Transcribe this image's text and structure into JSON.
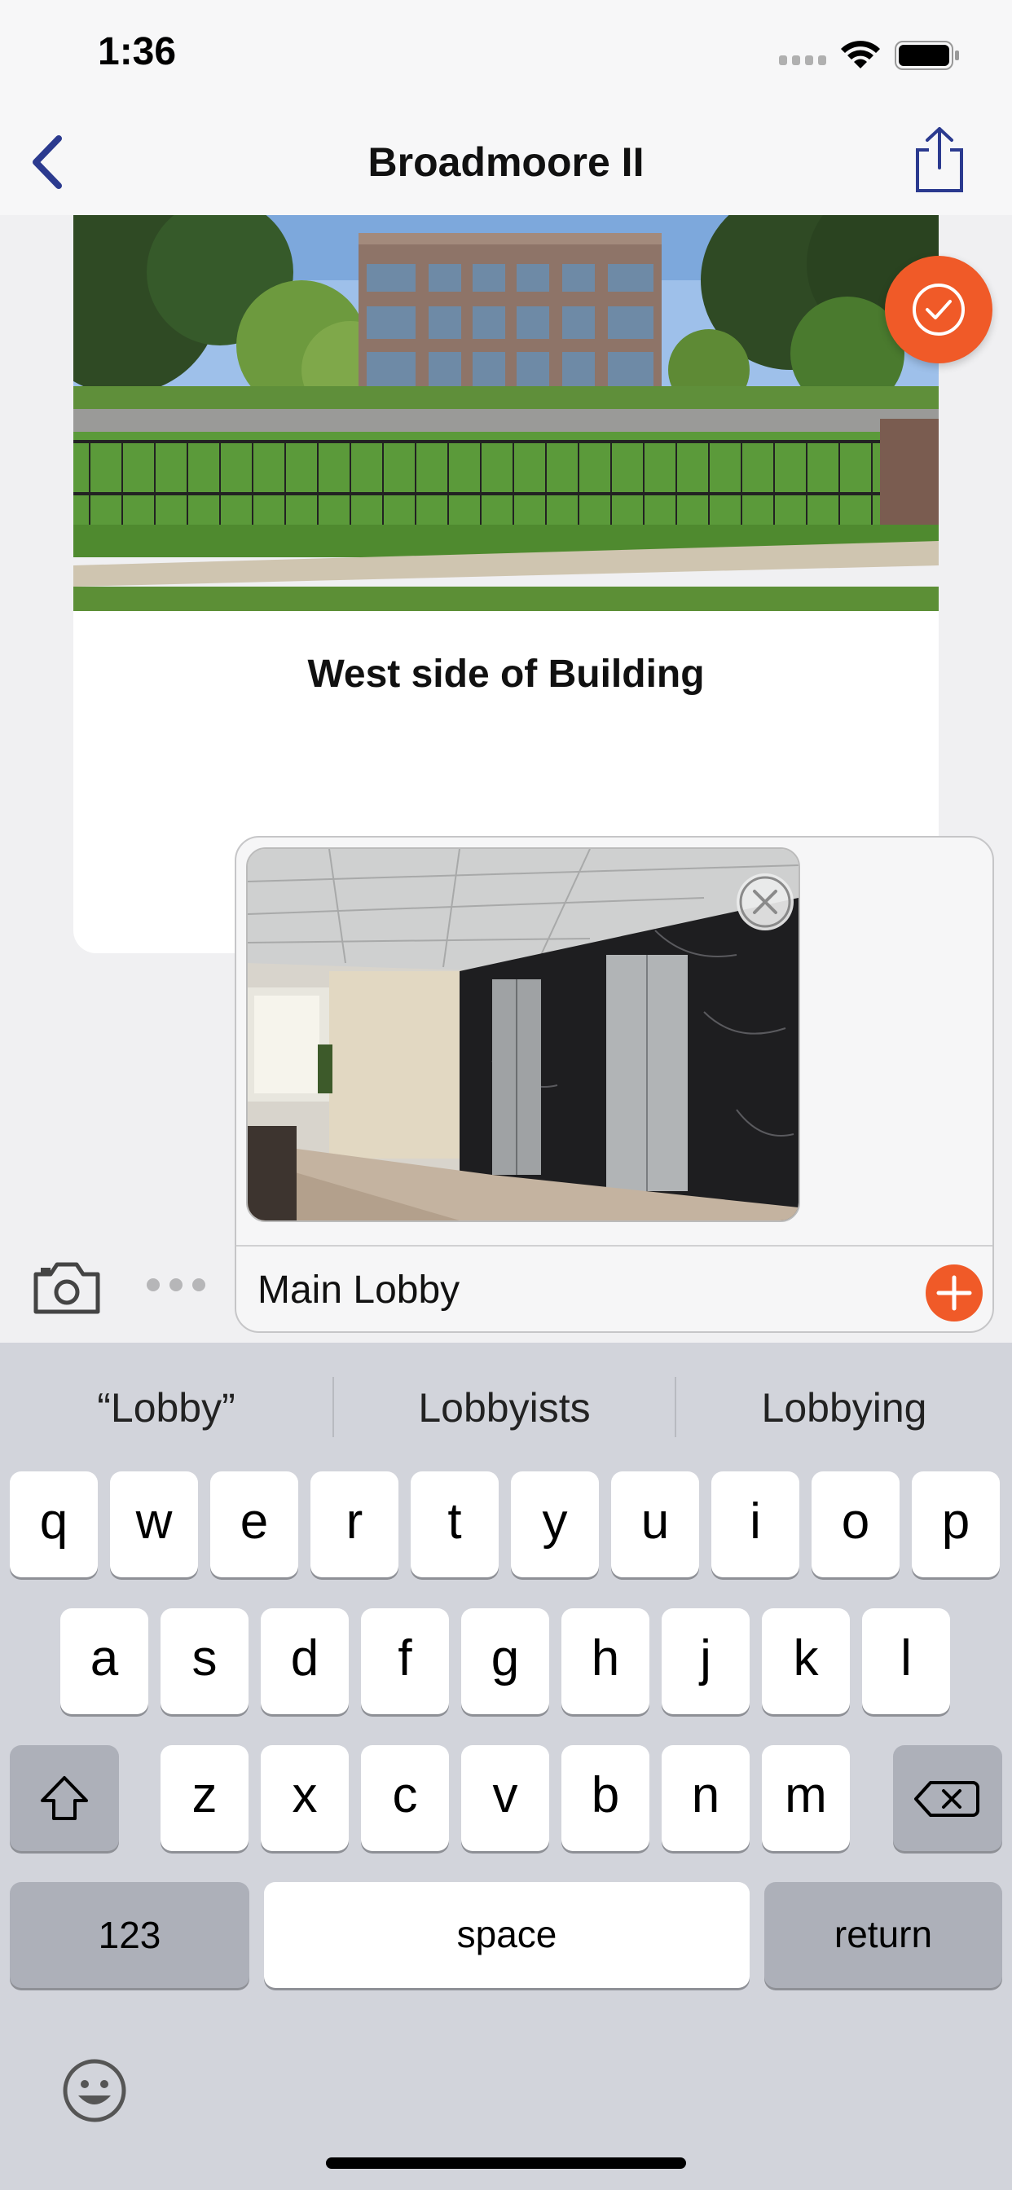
{
  "status_bar": {
    "time": "1:36"
  },
  "nav": {
    "title": "Broadmoore II"
  },
  "cards": [
    {
      "caption": "West side of Building"
    }
  ],
  "composer": {
    "caption_value": "Main Lobby"
  },
  "keyboard": {
    "suggestions": [
      "“Lobby”",
      "Lobbyists",
      "Lobbying"
    ],
    "row1": [
      "q",
      "w",
      "e",
      "r",
      "t",
      "y",
      "u",
      "i",
      "o",
      "p"
    ],
    "row2": [
      "a",
      "s",
      "d",
      "f",
      "g",
      "h",
      "j",
      "k",
      "l"
    ],
    "row3": [
      "z",
      "x",
      "c",
      "v",
      "b",
      "n",
      "m"
    ],
    "numbers_label": "123",
    "space_label": "space",
    "return_label": "return"
  },
  "icons": {
    "back": "chevron-left-icon",
    "share": "share-icon",
    "confirm": "checkmark-circle-icon",
    "remove": "close-icon",
    "add": "plus-icon",
    "camera": "camera-icon",
    "more": "ellipsis-icon",
    "shift": "shift-icon",
    "delete": "backspace-icon",
    "emoji": "emoji-icon"
  },
  "colors": {
    "accent": "#f05a28",
    "nav_tint": "#2b3a8f"
  }
}
